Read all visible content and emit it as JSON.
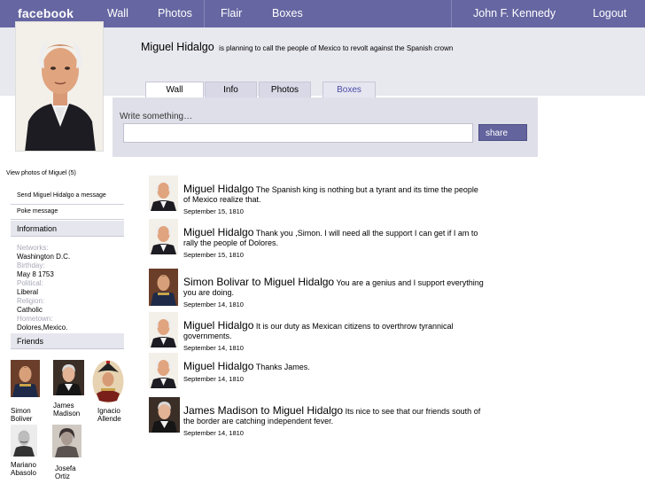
{
  "topbar": {
    "logo": "facebook",
    "nav": [
      "Wall",
      "Photos",
      "Flair",
      "Boxes"
    ],
    "user": "John F. Kennedy",
    "logout": "Logout"
  },
  "profile": {
    "name": "Miguel Hidalgo",
    "status": "is planning to call the people of Mexico to revolt against the Spanish crown"
  },
  "tabs": [
    "Wall",
    "Info",
    "Photos",
    "Boxes"
  ],
  "composer": {
    "label": "Write something…",
    "share": "share"
  },
  "sidebar": {
    "view_photos": "View photos of Miguel (5)",
    "send_message": "Send Miguel Hidalgo a message",
    "poke": "Poke message",
    "information_header": "Information",
    "info": [
      {
        "key": "Networks:",
        "value": "Washington D.C."
      },
      {
        "key": "Birthday:",
        "value": "May 8 1753"
      },
      {
        "key": "Political:",
        "value": "Liberal"
      },
      {
        "key": "Religion:",
        "value": "Catholic"
      },
      {
        "key": "Hometown:",
        "value": "Dolores,Mexico."
      }
    ],
    "friends_header": "Friends",
    "friends": [
      {
        "first": "Simon",
        "last": "Boliver"
      },
      {
        "first": "James",
        "last": "Madison"
      },
      {
        "first": "Ignacio",
        "last": "Allende"
      },
      {
        "first": "Mariano",
        "last": "Abasolo"
      },
      {
        "first": "Josefa",
        "last": "Ortiz"
      }
    ]
  },
  "feed": [
    {
      "author": "Miguel Hidalgo",
      "text": "The Spanish king is nothing but a tyrant and its time the people of Mexico realize that.",
      "date": "September 15, 1810"
    },
    {
      "author": "Miguel Hidalgo",
      "text": "Thank you ,Simon. I will need all the support I can get if I am to rally the people of Dolores.",
      "date": "September 15, 1810"
    },
    {
      "author": "Simon Bolivar to Miguel Hidalgo",
      "text": "You are a genius and I support everything you are doing.",
      "date": "September 14, 1810"
    },
    {
      "author": "Miguel Hidalgo",
      "text": "It is our duty as Mexican citizens to overthrow tyrannical governments.",
      "date": "September 14, 1810"
    },
    {
      "author": "Miguel Hidalgo",
      "text": "Thanks James.",
      "date": "September 14, 1810"
    },
    {
      "author": "James Madison to Miguel Hidalgo",
      "text": "Its nice to see that our friends south of the border are catching independent fever.",
      "date": "September 14, 1810"
    }
  ],
  "colors": {
    "topbar": "#6666a2",
    "accent": "#4a4aa8",
    "panel": "#e8e8ef"
  }
}
